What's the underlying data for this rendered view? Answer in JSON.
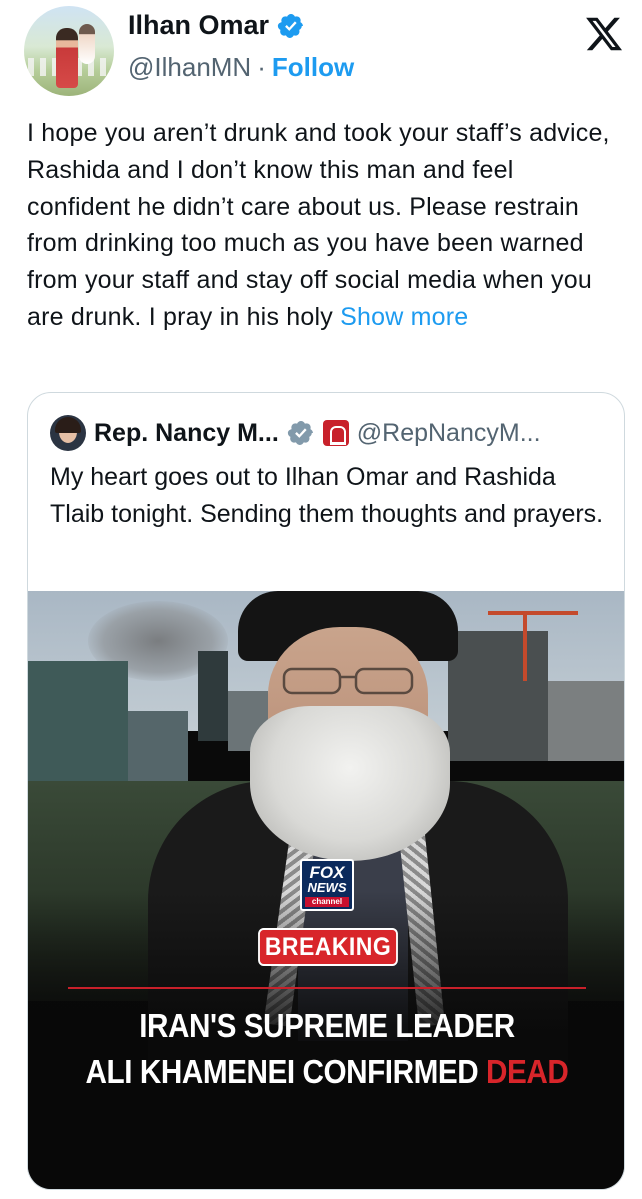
{
  "header": {
    "display_name": "Ilhan Omar",
    "handle": "@IlhanMN",
    "separator": "·",
    "follow_label": "Follow"
  },
  "tweet": {
    "text": "I hope you aren’t drunk and took your staff’s advice, Rashida and I don’t know this man and feel confident he didn’t care about us. Please restrain from drinking too much as you have been warned from your staff and stay off social media when you are drunk. I pray in his holy",
    "show_more_label": "Show more"
  },
  "quote": {
    "display_name": "Rep. Nancy M...",
    "handle": "@RepNancyM...",
    "text": "My heart goes out to Ilhan Omar and Rashida Tlaib tonight. Sending them thoughts and prayers.",
    "media": {
      "network_logo": [
        "FOX",
        "NEWS",
        "channel"
      ],
      "banner": "BREAKING",
      "headline_line1": "IRAN'S SUPREME LEADER",
      "headline_line2": "ALI KHAMENEI CONFIRMED",
      "headline_highlight": "DEAD"
    }
  },
  "colors": {
    "link": "#1d9bf0",
    "verified": "#1d9bf0",
    "text": "#0f1419",
    "secondary_text": "#536471",
    "breaking_red": "#d8252a"
  },
  "icons": {
    "verified": "verified-badge-icon",
    "x_logo": "x-logo-icon",
    "gov_badge": "government-affiliation-icon"
  }
}
